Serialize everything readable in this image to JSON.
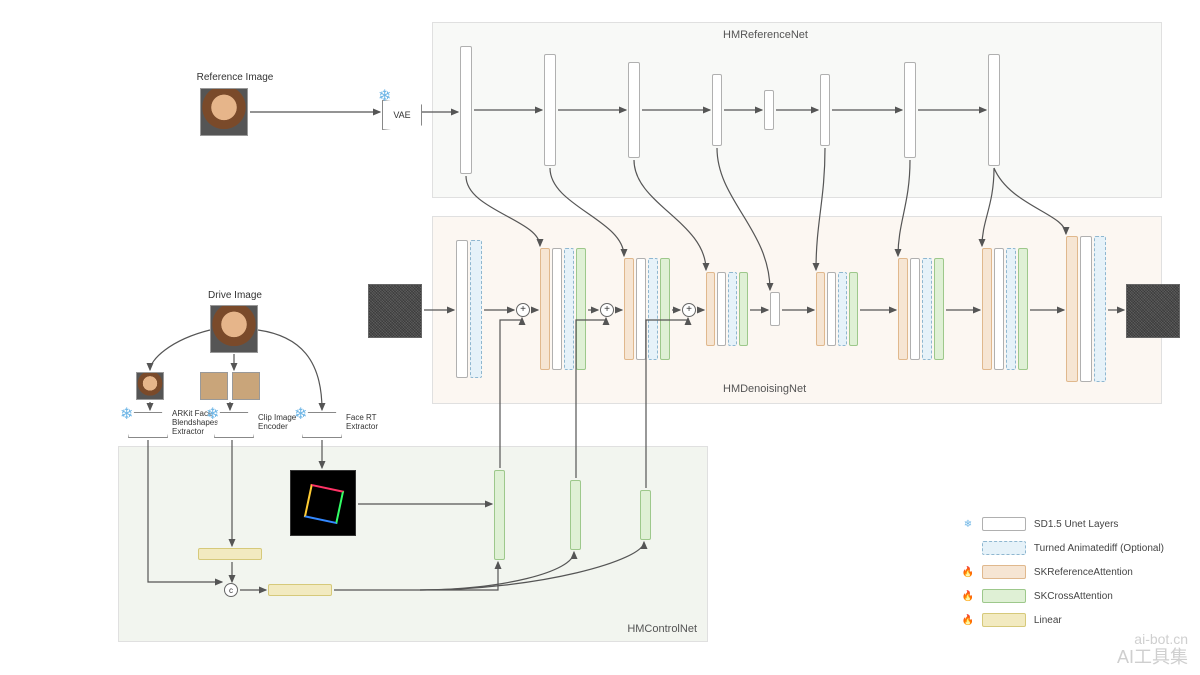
{
  "labels": {
    "reference_image": "Reference Image",
    "drive_image": "Drive Image",
    "vae": "VAE",
    "hm_reference_net": "HMReferenceNet",
    "hm_denoising_net": "HMDenoisingNet",
    "hm_control_net": "HMControlNet",
    "arkit": "ARKit Face\nBlendshapes\nExtractor",
    "clip": "Clip Image\nEncoder",
    "facert": "Face RT\nExtractor",
    "concat": "c"
  },
  "legend": {
    "sd_layers": "SD1.5 Unet Layers",
    "animatediff": "Turned Animatediff (Optional)",
    "ref_attention": "SKReferenceAttention",
    "cross_attention": "SKCrossAttention",
    "linear": "Linear"
  },
  "icons": {
    "frozen": "snowflake",
    "trainable": "flame"
  },
  "watermark": {
    "line1": "ai-bot.cn",
    "line2": "AI工具集"
  },
  "architecture": {
    "reference_net": {
      "type": "encoder_stack",
      "frozen": true,
      "stages": 8,
      "feeds_into": "denoising_net (skip connections per stage)"
    },
    "denoising_net": {
      "type": "UNet",
      "stages": 8,
      "per_stage_modules": [
        "sd_layer",
        "animatediff_optional",
        "ref_attention",
        "cross_attention"
      ],
      "input": "noise_latent",
      "output": "denoised_latent",
      "additive_injections_at_stages": [
        2,
        3,
        4
      ]
    },
    "control_net": {
      "inputs": [
        "drive_image",
        "face_crop",
        "eye_crops"
      ],
      "extractors": [
        {
          "name": "ARKit Face Blendshapes Extractor",
          "frozen": true
        },
        {
          "name": "Clip Image Encoder",
          "frozen": true
        },
        {
          "name": "Face RT Extractor",
          "frozen": true
        }
      ],
      "linear_projections": 2,
      "concat_then_linear": true,
      "control_outputs": 3,
      "injects_into_denoising_stages": [
        2,
        3,
        4
      ]
    },
    "vae": {
      "frozen": true,
      "role": "encode reference image"
    }
  }
}
